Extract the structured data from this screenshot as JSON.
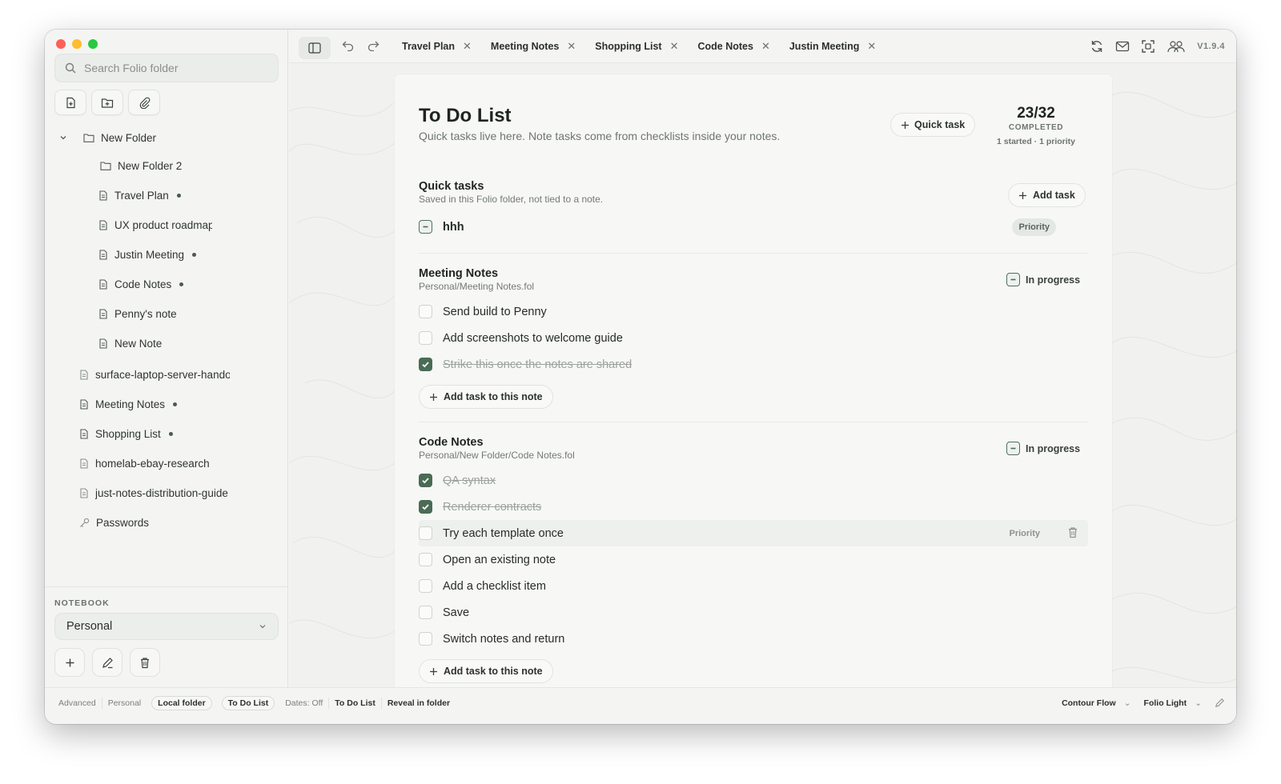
{
  "sidebar": {
    "search_placeholder": "Search Folio folder",
    "tree": [
      {
        "label": "New Folder",
        "type": "folder",
        "dot": false
      },
      {
        "label": "New Folder 2",
        "type": "folder",
        "dot": false
      },
      {
        "label": "Travel Plan",
        "type": "note",
        "dot": true
      },
      {
        "label": "UX product roadmap",
        "type": "note",
        "dot": false
      },
      {
        "label": "Justin Meeting",
        "type": "note",
        "dot": true
      },
      {
        "label": "Code Notes",
        "type": "note",
        "dot": true
      },
      {
        "label": "Penny's note",
        "type": "note",
        "dot": false
      },
      {
        "label": "New Note",
        "type": "note",
        "dot": false
      },
      {
        "label": "surface-laptop-server-handoff",
        "type": "doc",
        "dot": false
      },
      {
        "label": "Meeting Notes",
        "type": "note",
        "dot": true
      },
      {
        "label": "Shopping List",
        "type": "note",
        "dot": true
      },
      {
        "label": "homelab-ebay-research",
        "type": "doc",
        "dot": false
      },
      {
        "label": "just-notes-distribution-guide",
        "type": "doc",
        "dot": false
      },
      {
        "label": "Passwords",
        "type": "key",
        "dot": false
      }
    ],
    "notebook_label": "NOTEBOOK",
    "notebook_value": "Personal"
  },
  "tabs": [
    {
      "label": "Travel Plan"
    },
    {
      "label": "Meeting Notes"
    },
    {
      "label": "Shopping List"
    },
    {
      "label": "Code Notes"
    },
    {
      "label": "Justin Meeting"
    }
  ],
  "version": "V1.9.4",
  "page": {
    "title": "To Do List",
    "subtitle": "Quick tasks live here. Note tasks come from checklists inside your notes.",
    "quick_task_label": "Quick task",
    "stats_count": "23/32",
    "stats_label": "COMPLETED",
    "stats_meta": "1 started · 1 priority"
  },
  "sections": {
    "quick": {
      "title": "Quick tasks",
      "subtitle": "Saved in this Folio folder, not tied to a note.",
      "add_label": "Add task",
      "tasks": [
        {
          "text": "hhh",
          "state": "partial",
          "priority": "Priority"
        }
      ]
    },
    "meeting": {
      "title": "Meeting Notes",
      "path": "Personal/Meeting Notes.fol",
      "status": "In progress",
      "add_label": "Add task to this note",
      "tasks": [
        {
          "text": "Send build to Penny",
          "done": false
        },
        {
          "text": "Add screenshots to welcome guide",
          "done": false
        },
        {
          "text": "Strike this once the notes are shared",
          "done": true
        }
      ]
    },
    "code": {
      "title": "Code Notes",
      "path": "Personal/New Folder/Code Notes.fol",
      "status": "In progress",
      "add_label": "Add task to this note",
      "tasks": [
        {
          "text": "QA syntax",
          "done": true
        },
        {
          "text": "Renderer contracts",
          "done": true
        },
        {
          "text": "Try each template once",
          "done": false,
          "priority": "Priority"
        },
        {
          "text": "Open an existing note",
          "done": false
        },
        {
          "text": "Add a checklist item",
          "done": false
        },
        {
          "text": "Save",
          "done": false
        },
        {
          "text": "Switch notes and return",
          "done": false
        }
      ]
    }
  },
  "statusbar": {
    "left": [
      "Advanced",
      "Personal",
      "Local folder",
      "To Do List",
      "Dates: Off",
      "To Do List",
      "Reveal in folder"
    ],
    "theme_flow": "Contour Flow",
    "theme_name": "Folio Light"
  },
  "colors": {
    "accent": "#4a6b55",
    "background": "#f4f5f3"
  }
}
